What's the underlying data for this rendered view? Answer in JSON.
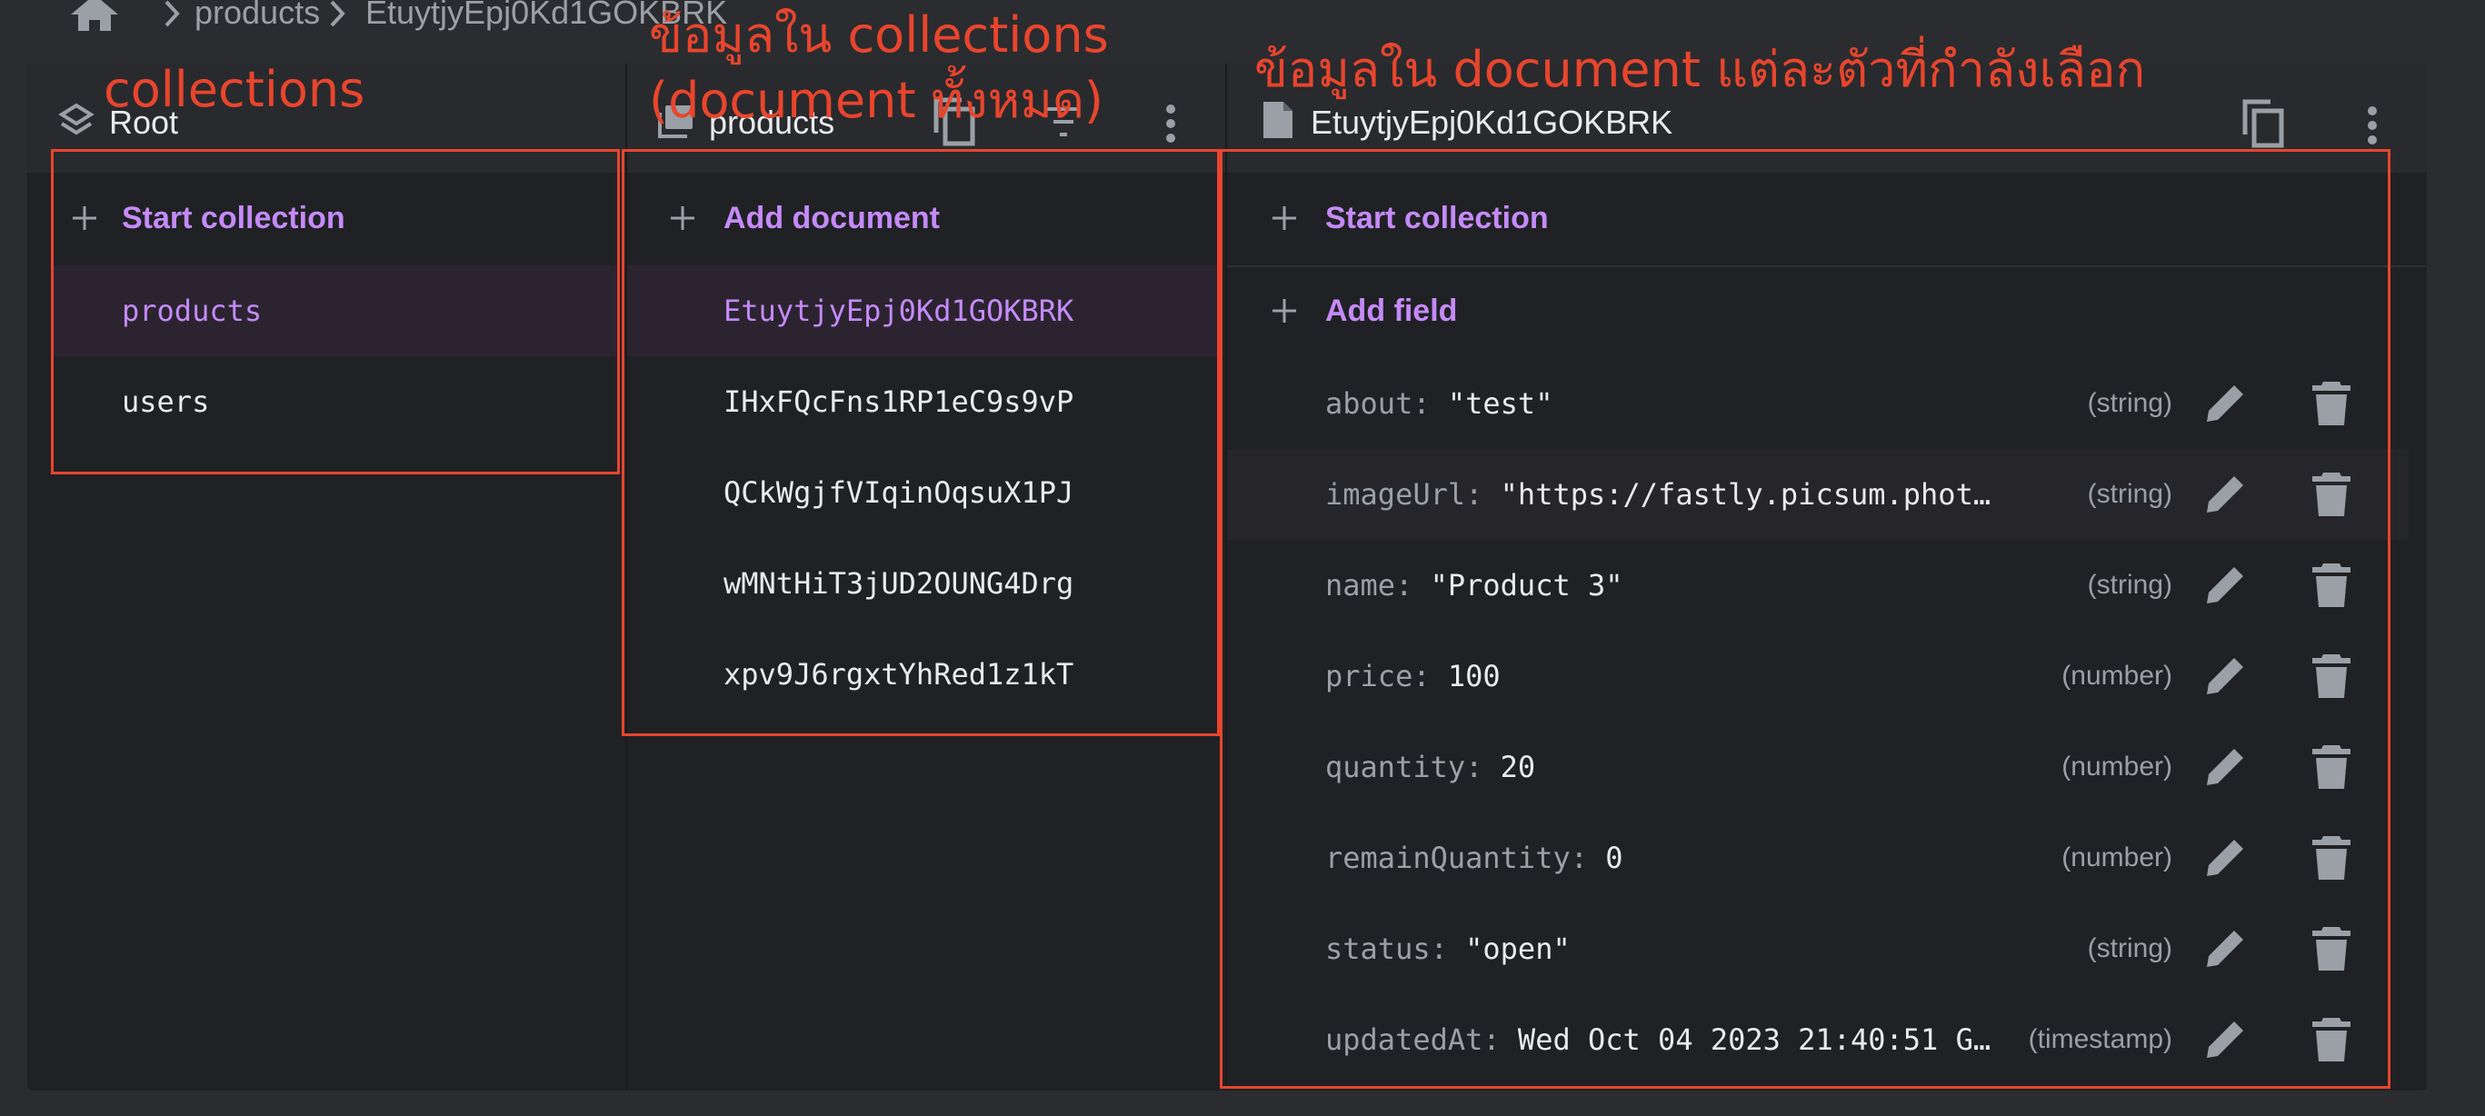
{
  "breadcrumb": {
    "items": [
      "products",
      "EtuytjyEpj0Kd1GOKBRK"
    ]
  },
  "root_panel": {
    "title": "Root",
    "action_label": "Start collection",
    "collections": [
      "products",
      "users"
    ]
  },
  "collection_panel": {
    "title": "products",
    "action_label": "Add document",
    "documents": [
      "EtuytjyEpj0Kd1GOKBRK",
      "IHxFQcFns1RP1eC9s9vP",
      "QCkWgjfVIqinOqsuX1PJ",
      "wMNtHiT3jUD2OUNG4Drg",
      "xpv9J6rgxtYhRed1z1kT"
    ]
  },
  "document_panel": {
    "title": "EtuytjyEpj0Kd1GOKBRK",
    "start_collection_label": "Start collection",
    "add_field_label": "Add field",
    "fields": [
      {
        "key": "about:",
        "value": "\"test\"",
        "type": "(string)"
      },
      {
        "key": "imageUrl:",
        "value": "\"https://fastly.picsum.photos/…",
        "type": "(string)"
      },
      {
        "key": "name:",
        "value": "\"Product 3\"",
        "type": "(string)"
      },
      {
        "key": "price:",
        "value": "100",
        "type": "(number)"
      },
      {
        "key": "quantity:",
        "value": "20",
        "type": "(number)"
      },
      {
        "key": "remainQuantity:",
        "value": "0",
        "type": "(number)"
      },
      {
        "key": "status:",
        "value": "\"open\"",
        "type": "(string)"
      },
      {
        "key": "updatedAt:",
        "value": "Wed Oct 04 2023 21:40:51 G…",
        "type": "(timestamp)"
      }
    ]
  },
  "annotations": {
    "collections": "collections",
    "documents_line1": "ข้อมูลใน collections",
    "documents_line2": "(document ทั้งหมด)",
    "document_detail": "ข้อมูลใน document แต่ละตัวที่กำลังเลือก"
  },
  "colors": {
    "accent": "#c58af9",
    "annotation": "#e8452d",
    "background": "#202124"
  },
  "icons": [
    "home-icon",
    "chevron-right-icon",
    "collection-stack-icon",
    "collection-icon",
    "copy-icon",
    "filter-icon",
    "more-vert-icon",
    "document-icon",
    "plus-icon",
    "edit-icon",
    "delete-icon"
  ]
}
